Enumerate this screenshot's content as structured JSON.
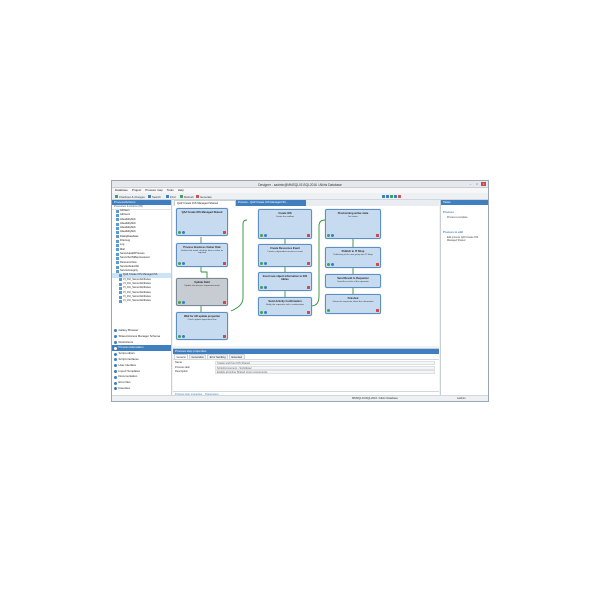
{
  "window": {
    "title": "Designer - sadmin@MMSQL01\\SQL2016 / Altiris Database"
  },
  "menu": [
    "Database",
    "Project",
    "Process map",
    "Tools",
    "Help"
  ],
  "toolbar": {
    "items": [
      "Checkout & changes",
      "Search",
      "Find",
      "Refresh",
      "Generate"
    ]
  },
  "left_panel": {
    "title": "Process/Actions",
    "filter": "Processes & Actions (55)",
    "tree": [
      {
        "label": "AllUsers",
        "sub": false
      },
      {
        "label": "AdUsers",
        "sub": false
      },
      {
        "label": "AlteabilityMdt",
        "sub": false
      },
      {
        "label": "AlteabilityMdt",
        "sub": false
      },
      {
        "label": "AlteabilityMdt",
        "sub": false
      },
      {
        "label": "AlteabilityMdt",
        "sub": false
      },
      {
        "label": "DialogDatabase",
        "sub": false
      },
      {
        "label": "FilterLog",
        "sub": false
      },
      {
        "label": "Log",
        "sub": false
      },
      {
        "label": "Mail",
        "sub": false
      },
      {
        "label": "ServerHealthProcess",
        "sub": false
      },
      {
        "label": "ServerSetToBeprocessed",
        "sub": false
      },
      {
        "label": "ResourceView",
        "sub": false
      },
      {
        "label": "ServiceSelectAlt",
        "sub": false
      },
      {
        "label": "ServiceIntegrity",
        "sub": false
      },
      {
        "label": "QA# Create IOS Managed Sh",
        "sub": true,
        "selected": true
      },
      {
        "label": "VI_OU_ServerAttributes",
        "sub": true
      },
      {
        "label": "VI_OU_ServerAttributes",
        "sub": true
      },
      {
        "label": "VI_OU_ServerAttributes",
        "sub": true
      },
      {
        "label": "VI_OU_ServerAttributes",
        "sub": true
      },
      {
        "label": "VI_OU_ServerAttributes",
        "sub": true
      },
      {
        "label": "VI_OU_ServerAttributes",
        "sub": true
      }
    ],
    "nav": [
      {
        "label": "Gallery Browser",
        "active": false
      },
      {
        "label": "Shared Access Manager Schema",
        "active": false
      },
      {
        "label": "Restrictions",
        "active": false
      },
      {
        "label": "Process Automation",
        "active": true
      },
      {
        "label": "Script editors",
        "active": false
      },
      {
        "label": "Script Interfaces",
        "active": false
      },
      {
        "label": "User Interface",
        "active": false
      },
      {
        "label": "Import Templates",
        "active": false
      },
      {
        "label": "Documentation",
        "active": false
      },
      {
        "label": "Error files",
        "active": false
      },
      {
        "label": "Favorites",
        "active": false
      }
    ]
  },
  "tabs": [
    "QA# Create IOS Managed Shared",
    "Process - QA# Create IOS Managed Sh..."
  ],
  "nodes": [
    {
      "id": "n1",
      "title": "QA# Create IOS Managed Shared",
      "desc": ""
    },
    {
      "id": "n2",
      "title": "Process Business Owner Rule",
      "desc": "Verifies that email, attribute have a value as required"
    },
    {
      "id": "n3",
      "title": "Update Field",
      "desc": "Update the process requested email"
    },
    {
      "id": "n4",
      "title": "Wait for AD update propertier",
      "desc": "Check update dependent flow"
    },
    {
      "id": "n5",
      "title": "Create IOS",
      "desc": "Create the mailbox"
    },
    {
      "id": "n6",
      "title": "Create Resources Event",
      "desc": "Create a dependent resources event"
    },
    {
      "id": "n7",
      "title": "Insert new object information to IOS tables",
      "desc": ""
    },
    {
      "id": "n8",
      "title": "Send Activity Confirmation",
      "desc": "Notify the requester with a confirmation"
    },
    {
      "id": "n9",
      "title": "Provisioning active state",
      "desc": "Set status"
    },
    {
      "id": "n10",
      "title": "Publish to IT Shop",
      "desc": "Publishing of the new group into IT Shop"
    },
    {
      "id": "n11",
      "title": "Send Result to Requester",
      "desc": "Send the results of the operation"
    },
    {
      "id": "n12",
      "title": "Finished",
      "desc": "Inform the requester about the information"
    }
  ],
  "properties": {
    "title": "Process step properties",
    "subtabs": [
      "General",
      "Generation",
      "Error handling",
      "Extended"
    ],
    "rows": [
      {
        "key": "Name",
        "value": "Create and then IOS Shared"
      },
      {
        "key": "Process task",
        "value": "ScriptComponent - ScriptExec"
      },
      {
        "key": "Description",
        "value": "Enable all online Shared group components"
      }
    ],
    "bottom_tabs": [
      "Process step properties",
      "Parameters"
    ]
  },
  "right_panel": {
    "title": "Tasks",
    "sections": [
      {
        "heading": "Process",
        "link": "Process a template"
      },
      {
        "heading": "Process to edit",
        "link": "Edit process QA# Create IOS Managed Shared"
      }
    ]
  },
  "status": {
    "left": "",
    "db": "MMSQL01\\SQL2016 / Altiris Database",
    "user": "sadmin"
  }
}
